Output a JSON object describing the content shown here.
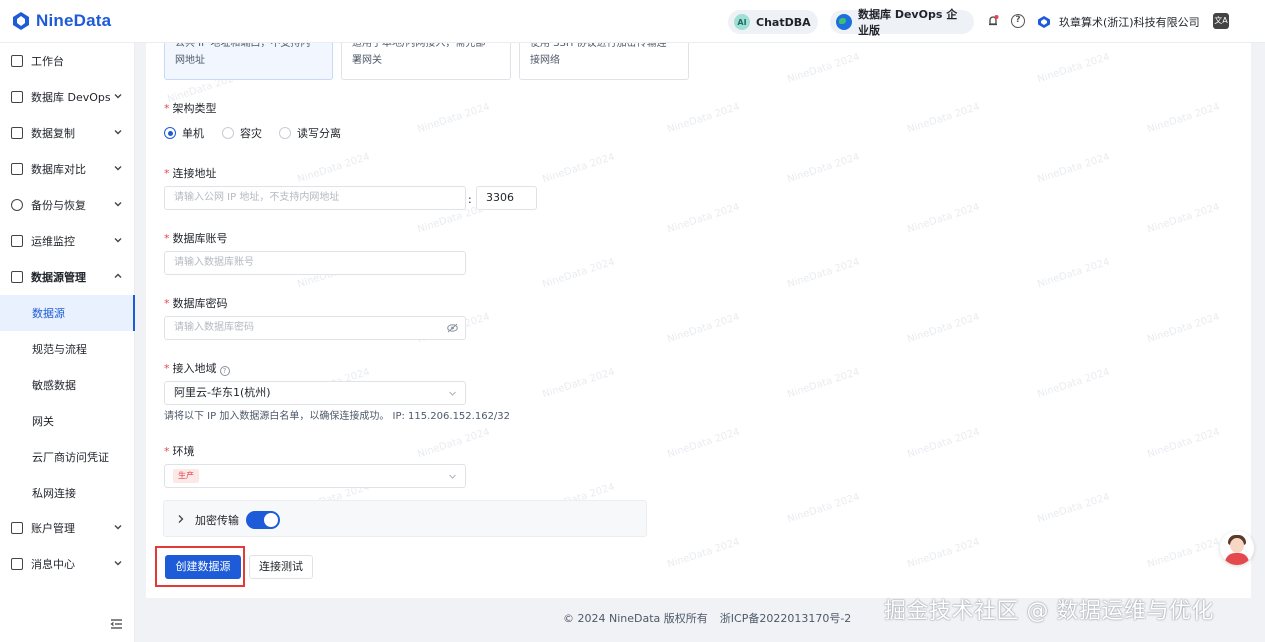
{
  "header": {
    "brand": "NineData",
    "chatdba": "ChatDBA",
    "devops_edition": "数据库 DevOps 企业版",
    "company": "玖章算术(浙江)科技有限公司",
    "ai_badge": "AI"
  },
  "sidebar": {
    "items": [
      {
        "label": "工作台",
        "icon": "home-icon"
      },
      {
        "label": "数据库 DevOps",
        "icon": "monitor-icon"
      },
      {
        "label": "数据复制",
        "icon": "copy-icon"
      },
      {
        "label": "数据库对比",
        "icon": "compare-icon"
      },
      {
        "label": "备份与恢复",
        "icon": "cloud-icon"
      },
      {
        "label": "运维监控",
        "icon": "alarm-icon"
      },
      {
        "label": "数据源管理",
        "icon": "datasource-icon"
      }
    ],
    "sub_items": [
      "数据源",
      "规范与流程",
      "敏感数据",
      "网关",
      "云厂商访问凭证",
      "私网连接"
    ],
    "bottom_items": [
      {
        "label": "账户管理",
        "icon": "account-icon"
      },
      {
        "label": "消息中心",
        "icon": "mail-icon"
      }
    ]
  },
  "cards": [
    {
      "line1": "公共 IP 地址和端口，不支持内",
      "line2": "网地址"
    },
    {
      "line1": "适用于本地/内网接入，需先部",
      "line2": "署网关"
    },
    {
      "line1": "使用 SSH 协议进行加密传输连",
      "line2": "接网络"
    }
  ],
  "form": {
    "arch_label": "架构类型",
    "arch_options": [
      "单机",
      "容灾",
      "读写分离"
    ],
    "addr_label": "连接地址",
    "addr_placeholder": "请输入公网 IP 地址，不支持内网地址",
    "addr_colon": ":",
    "port": "3306",
    "account_label": "数据库账号",
    "account_placeholder": "请输入数据库账号",
    "password_label": "数据库密码",
    "password_placeholder": "请输入数据库密码",
    "region_label": "接入地域",
    "region_help": "?",
    "region_value": "阿里云-华东1(杭州)",
    "whitelist_hint": "请将以下 IP 加入数据源白名单，以确保连接成功。 IP: 115.206.152.162/32",
    "env_label": "环境",
    "env_tag": "生产",
    "encrypt_label": "加密传输",
    "create_button": "创建数据源",
    "test_button": "连接测试"
  },
  "watermark_text": "NineData 2024",
  "footer": {
    "copyright": "© 2024 NineData 版权所有",
    "icp": "浙ICP备2022013170号-2"
  },
  "overlay_text": "掘金技术社区 @ 数据运维与优化"
}
